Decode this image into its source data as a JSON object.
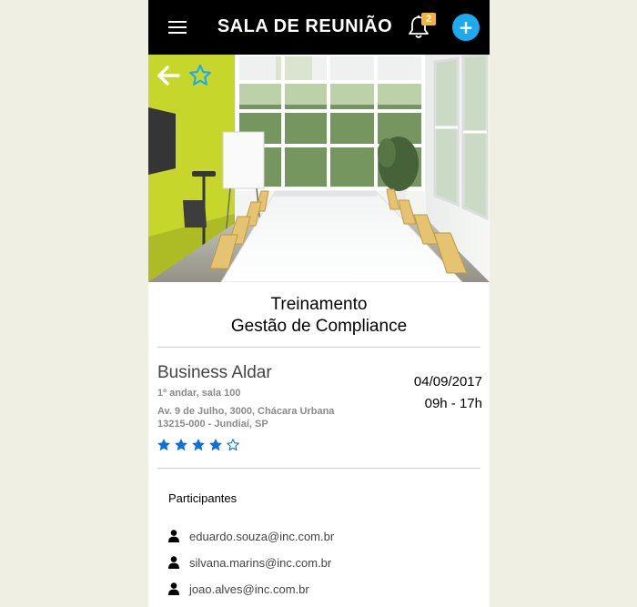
{
  "header": {
    "title": "SALA DE REUNIÃO",
    "notification_count": "2",
    "add_label": "+",
    "menu_icon": "hamburger-menu-icon",
    "bell_icon": "bell-icon",
    "background": "#000000",
    "badge_color": "#f4b33b",
    "add_color": "#1eaaf1"
  },
  "hero": {
    "back_icon": "arrow-left-icon",
    "favorite_icon": "star-outline-icon",
    "favorite_color": "#1eaaf1"
  },
  "event": {
    "title_line1": "Treinamento",
    "title_line2": "Gestão de Compliance"
  },
  "venue": {
    "name": "Business Aldar",
    "floor": "1º andar, sala 100",
    "address_line1": "Av. 9 de Julho, 3000, Chácara Urbana",
    "address_line2": "13215-000 - Jundiaí, SP",
    "rating": 4,
    "rating_max": 5,
    "star_color": "#0a6fe0"
  },
  "schedule": {
    "date": "04/09/2017",
    "time": "09h - 17h"
  },
  "participants": {
    "title": "Participantes",
    "list": [
      "eduardo.souza@inc.com.br",
      "silvana.marins@inc.com.br",
      "joao.alves@inc.com.br"
    ]
  }
}
